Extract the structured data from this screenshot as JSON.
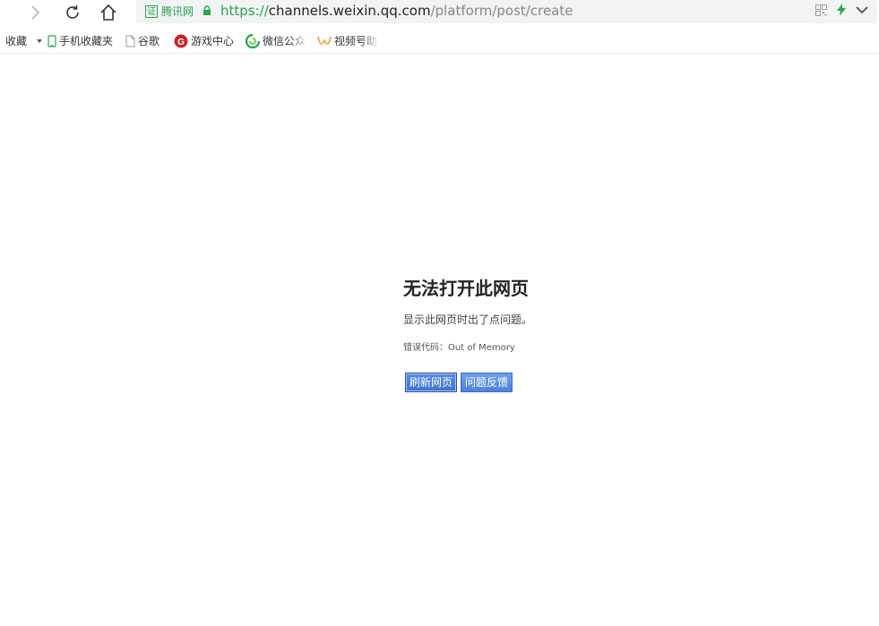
{
  "browser": {
    "address_bar": {
      "cert_label": "腾讯网",
      "cert_badge": "证",
      "url_scheme": "https://",
      "url_host": "channels.weixin.qq.com",
      "url_path": "/platform/post/create"
    },
    "bookmarks": [
      {
        "label": "收藏",
        "icon": "favorites-dropdown-icon"
      },
      {
        "label": "手机收藏夹",
        "icon": "phone-icon"
      },
      {
        "label": "谷歌",
        "icon": "page-icon"
      },
      {
        "label": "游戏中心",
        "icon": "game-center-icon"
      },
      {
        "label": "微信公众",
        "icon": "wechat-mp-icon"
      },
      {
        "label": "视频号助",
        "icon": "channels-icon"
      }
    ]
  },
  "error_page": {
    "title": "无法打开此网页",
    "description": "显示此网页时出了点问题。",
    "code_line": "错误代码：Out of Memory",
    "refresh_button": "刷新网页",
    "feedback_button": "问题反馈"
  },
  "colors": {
    "secure_green": "#2aa44f",
    "button_blue": "#4e83dc"
  }
}
